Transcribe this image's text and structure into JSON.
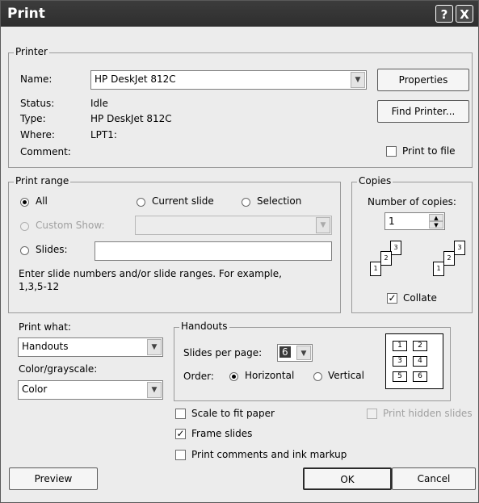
{
  "window": {
    "title": "Print",
    "help_glyph": "?",
    "close_glyph": "X"
  },
  "printer": {
    "group_label": "Printer",
    "name_label": "Name:",
    "name_value": "HP DeskJet 812C",
    "status_label": "Status:",
    "status_value": "Idle",
    "type_label": "Type:",
    "type_value": "HP DeskJet 812C",
    "where_label": "Where:",
    "where_value": "LPT1:",
    "comment_label": "Comment:",
    "properties_button": "Properties",
    "find_printer_button": "Find Printer...",
    "print_to_file_label": "Print to file"
  },
  "print_range": {
    "group_label": "Print range",
    "all_label": "All",
    "current_slide_label": "Current slide",
    "selection_label": "Selection",
    "custom_show_label": "Custom Show:",
    "slides_label": "Slides:",
    "hint_line1": "Enter slide numbers and/or slide ranges. For example,",
    "hint_line2": "1,3,5-12"
  },
  "copies": {
    "group_label": "Copies",
    "number_label": "Number of copies:",
    "number_value": "1",
    "collate_label": "Collate",
    "collate_checked": true,
    "page_numbers": [
      "1",
      "2",
      "3"
    ]
  },
  "print_what": {
    "label": "Print what:",
    "value": "Handouts",
    "color_label": "Color/grayscale:",
    "color_value": "Color"
  },
  "handouts": {
    "group_label": "Handouts",
    "slides_per_page_label": "Slides per page:",
    "slides_per_page_value": "6",
    "order_label": "Order:",
    "horizontal_label": "Horizontal",
    "vertical_label": "Vertical",
    "preview_cells": [
      "1",
      "2",
      "3",
      "4",
      "5",
      "6"
    ]
  },
  "options": {
    "scale_to_fit_label": "Scale to fit paper",
    "frame_slides_label": "Frame slides",
    "print_comments_label": "Print comments and ink markup",
    "print_hidden_label": "Print hidden slides"
  },
  "buttons": {
    "preview": "Preview",
    "ok": "OK",
    "cancel": "Cancel"
  }
}
